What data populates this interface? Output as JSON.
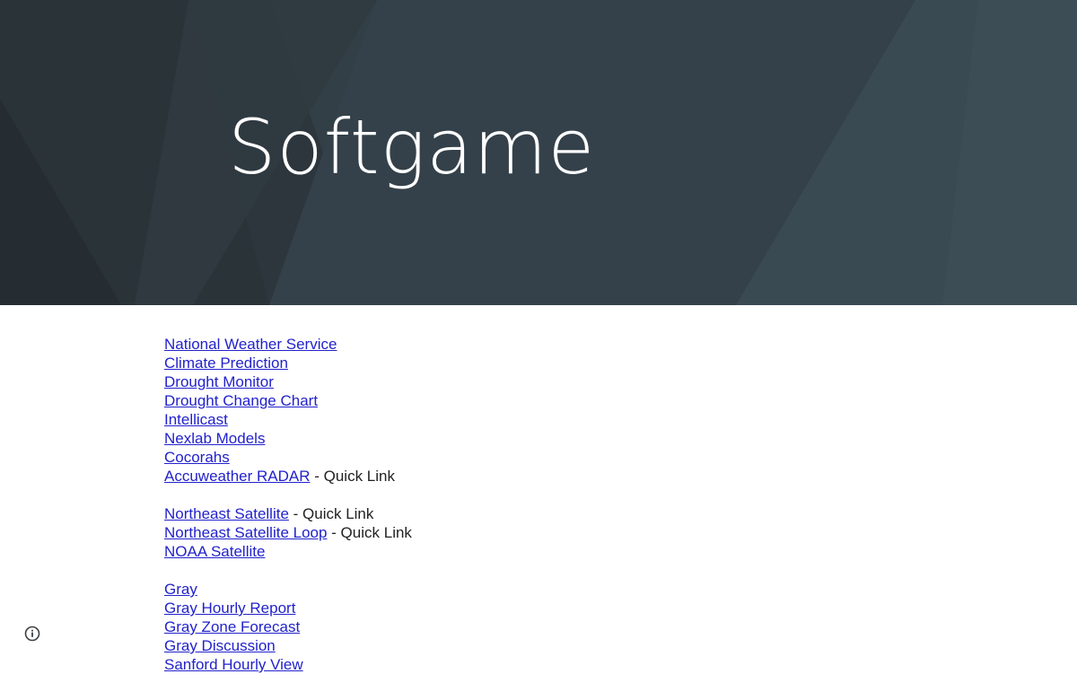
{
  "site": {
    "title": "Softgame"
  },
  "links": {
    "nws": "National Weather Service",
    "climate": "Climate Prediction",
    "drought_monitor": "Drought Monitor",
    "drought_change": "Drought Change Chart",
    "intellicast": "Intellicast",
    "nexlab": "Nexlab Models",
    "cocorahs": "Cocorahs",
    "accuweather_radar": "Accuweather RADAR",
    "northeast_satellite": "Northeast Satellite",
    "northeast_satellite_loop": "Northeast Satellite Loop",
    "noaa_satellite": "NOAA Satellite",
    "gray": "Gray",
    "gray_hourly": "Gray Hourly Report",
    "gray_zone": "Gray Zone Forecast",
    "gray_discussion": "Gray Discussion",
    "sanford_hourly": "Sanford Hourly View"
  },
  "suffix": {
    "quick_link": " - Quick Link"
  },
  "footer": {
    "info_icon": "info-icon"
  },
  "colors": {
    "hero_bg": "#323d44",
    "link": "#2222cc",
    "text": "#212121"
  }
}
